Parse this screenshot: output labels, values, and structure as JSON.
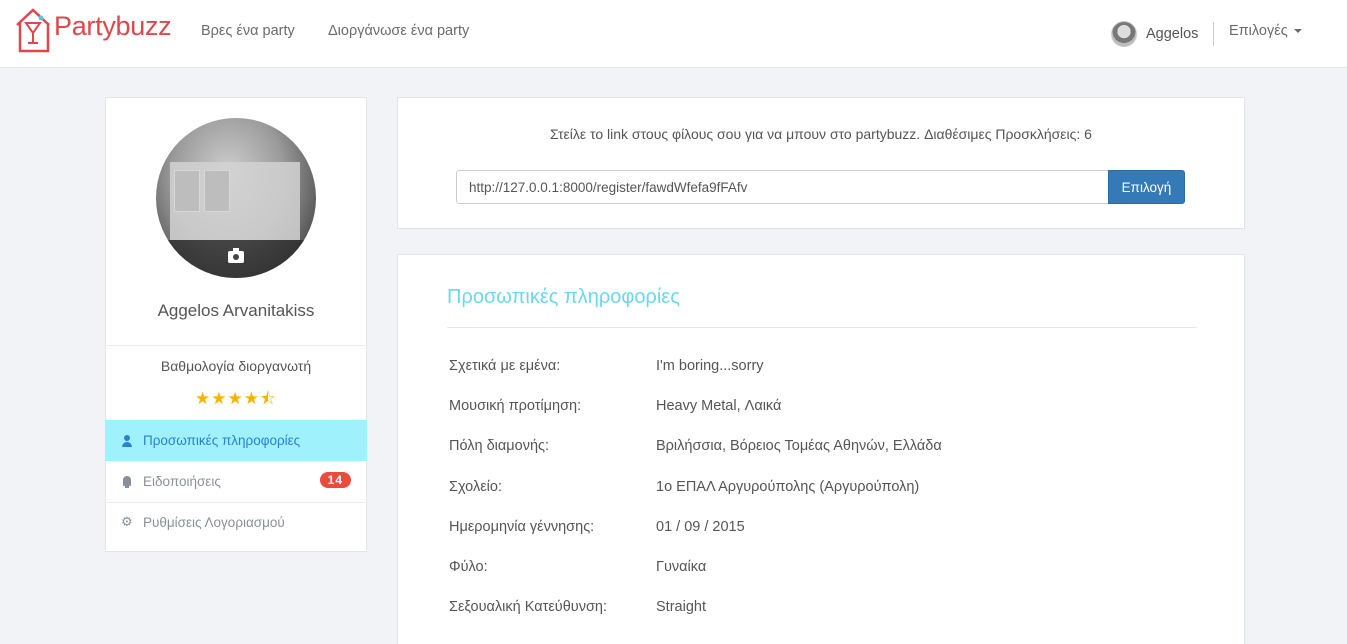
{
  "navbar": {
    "brand": "Partybuzz",
    "links": [
      "Βρες ένα party",
      "Διοργάνωσε ένα party"
    ],
    "user_name": "Aggelos",
    "options_label": "Επιλογές"
  },
  "sidebar": {
    "profile_name": "Aggelos Arvanitakiss",
    "rating_label": "Βαθμολογία διοργανωτή",
    "rating": 4.5,
    "stars": "★★★★⯪",
    "menu": [
      {
        "label": "Προσωπικές πληροφορίες",
        "icon": "user-icon",
        "active": true
      },
      {
        "label": "Ειδοποιήσεις",
        "icon": "bell-icon",
        "badge": "14"
      },
      {
        "label": "Ρυθμίσεις Λογοριασμού",
        "icon": "gear-icon"
      }
    ]
  },
  "invite": {
    "text": "Στείλε το link στους φίλους σου για να μπουν στο partybuzz. Διαθέσιμες Προσκλήσεις: 6",
    "link_value": "http://127.0.0.1:8000/register/fawdWfefa9fFAfv",
    "button_label": "Επιλογή"
  },
  "info": {
    "title": "Προσωπικές πληροφορίες",
    "rows": [
      {
        "label": "Σχετικά με εμένα:",
        "value": "I'm boring...sorry"
      },
      {
        "label": "Μουσική προτίμηση:",
        "value": "Heavy Metal, Λαικά"
      },
      {
        "label": "Πόλη διαμονής:",
        "value": "Βριλήσσια, Βόρειος Τομέας Αθηνών, Ελλάδα"
      },
      {
        "label": "Σχολείο:",
        "value": "1ο ΕΠΑΛ Αργυρούπολης (Αργυρούπολη)"
      },
      {
        "label": "Ημερομηνία γέννησης:",
        "value": "01 / 09 / 2015"
      },
      {
        "label": "Φύλο:",
        "value": "Γυναίκα"
      },
      {
        "label": "Σεξουαλική Κατεύθυνση:",
        "value": "Straight"
      }
    ]
  },
  "colors": {
    "brand": "#e0474c",
    "accent": "#6ad8ee",
    "primary_button": "#337ab7",
    "active_menu_bg": "#9ff2fb",
    "badge": "#e84c3d",
    "stars": "#f5b400"
  }
}
